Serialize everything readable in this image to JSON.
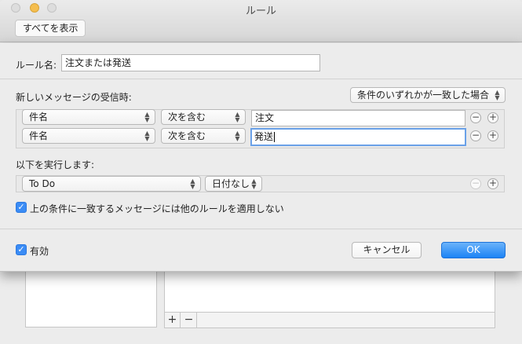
{
  "window": {
    "title": "ルール",
    "show_all_label": "すべてを表示"
  },
  "background": {
    "add_label": "+",
    "remove_label": "−",
    "move_up_label": "▲",
    "move_down_label": "▼"
  },
  "sheet": {
    "rule_name_label": "ルール名:",
    "rule_name_value": "注文または発送",
    "when_label": "新しいメッセージの受信時:",
    "match_mode": "条件のいずれかが一致した場合",
    "conditions": [
      {
        "field": "件名",
        "operator": "次を含む",
        "value": "注文"
      },
      {
        "field": "件名",
        "operator": "次を含む",
        "value": "発送"
      }
    ],
    "actions_label": "以下を実行します:",
    "actions": [
      {
        "type": "To Do",
        "option": "日付なし"
      }
    ],
    "stop_rules_label": "上の条件に一致するメッセージには他のルールを適用しない",
    "stop_rules_checked": true,
    "enabled_label": "有効",
    "enabled_checked": true,
    "cancel_label": "キャンセル",
    "ok_label": "OK",
    "add_symbol": "+",
    "remove_symbol": "−",
    "check_symbol": "✓"
  },
  "colors": {
    "accent": "#1c83f5",
    "focus_ring": "#6aa1e8"
  }
}
